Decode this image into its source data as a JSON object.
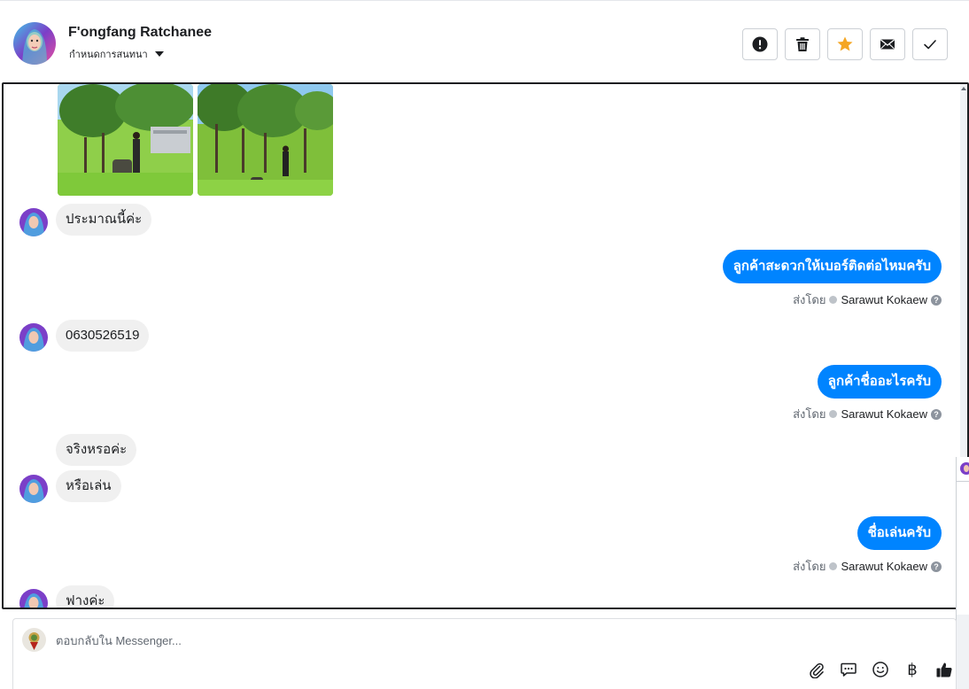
{
  "header": {
    "contact_name": "F'ongfang Ratchanee",
    "assign_label": "กำหนดการสนทนา",
    "actions": [
      {
        "name": "report-button",
        "icon": "exclamation-icon"
      },
      {
        "name": "delete-button",
        "icon": "trash-icon"
      },
      {
        "name": "star-button",
        "icon": "star-icon"
      },
      {
        "name": "mark-unread-button",
        "icon": "envelope-icon"
      },
      {
        "name": "mark-done-button",
        "icon": "check-icon"
      }
    ]
  },
  "conversation": {
    "incoming": [
      {
        "text": "ประมาณนี้ค่ะ"
      },
      {
        "text": "0630526519"
      },
      {
        "text": "จริงหรอค่ะ"
      },
      {
        "text": "หรือเล่น"
      },
      {
        "text": "ฟางค่ะ"
      }
    ],
    "outgoing": [
      {
        "text": "ลูกค้าสะดวกให้เบอร์ติดต่อไหมครับ",
        "sent_by_label": "ส่งโดย",
        "sender": "Sarawut Kokaew"
      },
      {
        "text": "ลูกค้าชื่ออะไรครับ",
        "sent_by_label": "ส่งโดย",
        "sender": "Sarawut Kokaew"
      },
      {
        "text": "ชื่อเล่นครับ",
        "sent_by_label": "ส่งโดย",
        "sender": "Sarawut Kokaew"
      }
    ]
  },
  "composer": {
    "placeholder": "ตอบกลับใน Messenger...",
    "currency_symbol": "฿"
  },
  "colors": {
    "outgoing_bubble": "#0084ff",
    "incoming_bubble": "#f0f0f0",
    "star_accent": "#f5a623"
  }
}
